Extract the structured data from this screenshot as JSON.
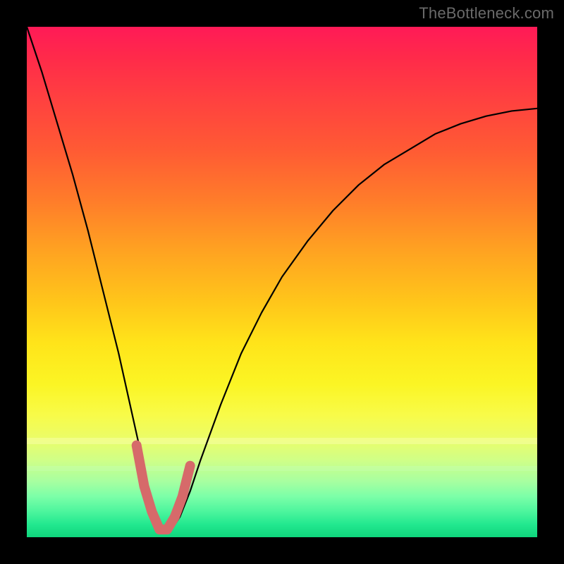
{
  "watermark": "TheBottleneck.com",
  "chart_data": {
    "type": "line",
    "title": "",
    "xlabel": "",
    "ylabel": "",
    "xlim": [
      0,
      100
    ],
    "ylim": [
      0,
      100
    ],
    "grid": false,
    "legend": false,
    "notes": "Bottleneck-style V-curve overlaid on a vertical red→green gradient. No visible axis tick labels or numeric values. Minimum of the curve is near x≈26, y≈0. A short salmon-colored segment highlights the valley.",
    "series": [
      {
        "name": "curve",
        "color": "#000000",
        "x": [
          0,
          3,
          6,
          9,
          12,
          15,
          18,
          20,
          22,
          24,
          26,
          28,
          30,
          32,
          34,
          38,
          42,
          46,
          50,
          55,
          60,
          65,
          70,
          75,
          80,
          85,
          90,
          95,
          100
        ],
        "y": [
          100,
          91,
          81,
          71,
          60,
          48,
          36,
          27,
          18,
          9,
          2,
          1,
          4,
          9,
          15,
          26,
          36,
          44,
          51,
          58,
          64,
          69,
          73,
          76,
          79,
          81,
          82.5,
          83.5,
          84
        ]
      },
      {
        "name": "valley-highlight",
        "color": "#d66a6a",
        "x": [
          21.5,
          23,
          24.5,
          26,
          27.5,
          29,
          30.5,
          32
        ],
        "y": [
          18,
          10,
          5,
          1.5,
          1.5,
          4,
          8,
          14
        ]
      }
    ]
  }
}
